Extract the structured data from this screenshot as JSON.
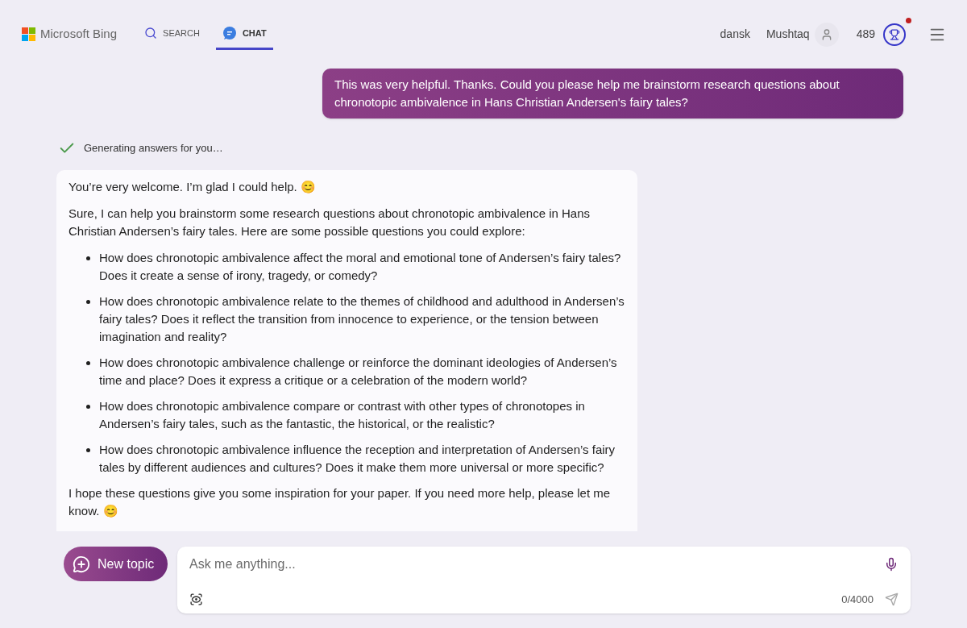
{
  "header": {
    "brand": "Microsoft Bing",
    "tabs": [
      {
        "label": "SEARCH",
        "kind": "search",
        "selected": false
      },
      {
        "label": "CHAT",
        "kind": "chat",
        "selected": true
      }
    ],
    "language": "dansk",
    "user": "Mushtaq",
    "points": "489",
    "rewards_notification": true
  },
  "user_message": "This was very helpful. Thanks. Could you please help me brainstorm research questions about chronotopic ambivalence in Hans Christian Andersen's fairy tales?",
  "status": {
    "text": "Generating answers for you…",
    "done": true
  },
  "answer": {
    "intro": "You’re very welcome. I’m glad I could help. 😊",
    "lead": "Sure, I can help you brainstorm some research questions about chronotopic ambivalence in Hans Christian Andersen’s fairy tales. Here are some possible questions you could explore:",
    "bullets": [
      "How does chronotopic ambivalence affect the moral and emotional tone of Andersen’s fairy tales? Does it create a sense of irony, tragedy, or comedy?",
      "How does chronotopic ambivalence relate to the themes of childhood and adulthood in Andersen’s fairy tales? Does it reflect the transition from innocence to experience, or the tension between imagination and reality?",
      "How does chronotopic ambivalence challenge or reinforce the dominant ideologies of Andersen’s time and place? Does it express a critique or a celebration of the modern world?",
      "How does chronotopic ambivalence compare or contrast with other types of chronotopes in Andersen’s fairy tales, such as the fantastic, the historical, or the realistic?",
      "How does chronotopic ambivalence influence the reception and interpretation of Andersen’s fairy tales by different audiences and cultures? Does it make them more universal or more specific?"
    ],
    "closing": "I hope these questions give you some inspiration for your paper. If you need more help, please let me know. 😊"
  },
  "composer": {
    "new_topic": "New topic",
    "placeholder": "Ask me anything...",
    "counter": "0/4000"
  }
}
